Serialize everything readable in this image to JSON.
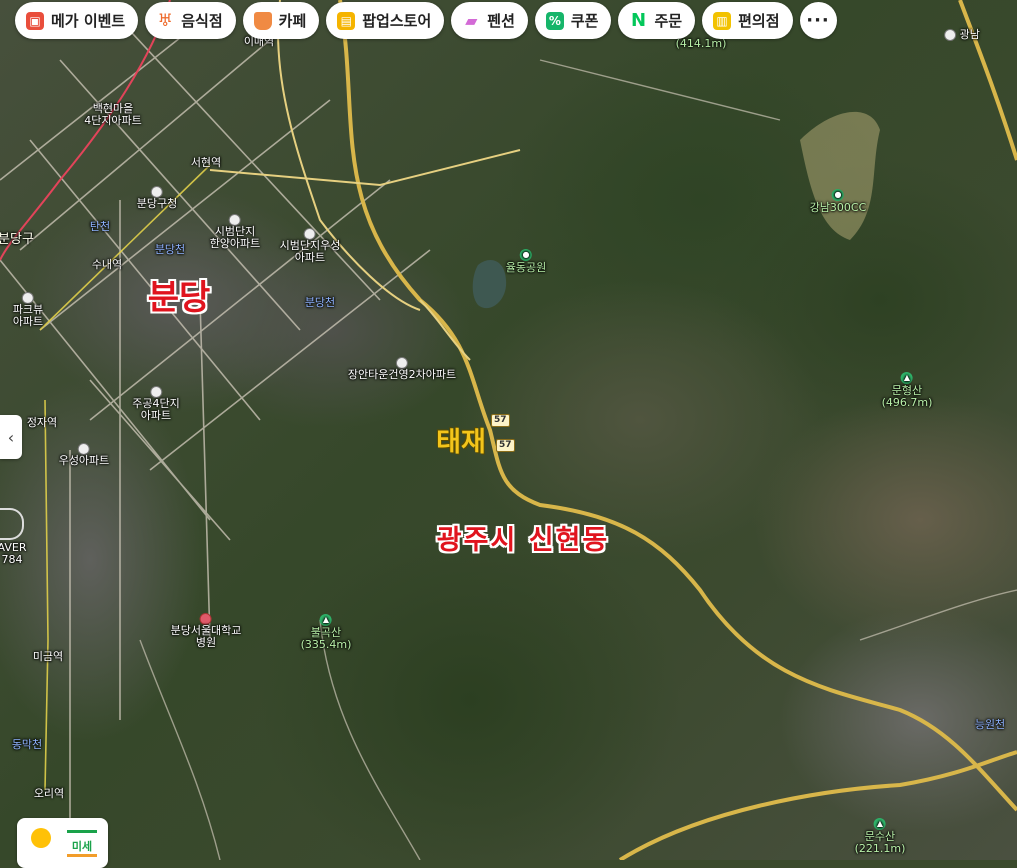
{
  "chips": [
    {
      "label": "메가 이벤트",
      "icon": "gift-icon"
    },
    {
      "label": "음식점",
      "icon": "restaurant-icon"
    },
    {
      "label": "카페",
      "icon": "coffee-icon"
    },
    {
      "label": "팝업스토어",
      "icon": "store-icon"
    },
    {
      "label": "펜션",
      "icon": "bed-icon"
    },
    {
      "label": "쿠폰",
      "icon": "coupon-icon"
    },
    {
      "label": "주문",
      "icon": "naver-order-icon"
    },
    {
      "label": "편의점",
      "icon": "convenience-store-icon"
    }
  ],
  "more_label": "···",
  "overlays": {
    "bundang": "분당",
    "taejae": "태재",
    "sinhyeon": "광주시 신현동"
  },
  "places": {
    "p1": "백현마을\n4단지아파트",
    "p2": "서현역",
    "p3": "분당구청",
    "p4": "시범단지\n한양아파트",
    "p5": "시범단지우성\n아파트",
    "p6": "탄천",
    "p7": "분당천",
    "p8": "수내역",
    "p9": "분당천",
    "p10": "장안타운건영2차아파트",
    "p11": "파크뷰\n아파트",
    "p12": "주공4단지\n아파트",
    "p13": "정자역",
    "p14": "우성아파트",
    "p15": "분당서울대학교\n병원",
    "p16": "미금역",
    "p17": "동막천",
    "p18": "오리역",
    "p19": "율동공원",
    "p20": "강남300CC",
    "p21": "광남",
    "p22": "분당구",
    "p23": "AVER\n784",
    "p24": "능원천",
    "p25": "이매역",
    "p26": "탄천",
    "p27": "정자"
  },
  "mountains": {
    "m1": "(414.1m)",
    "m2": "문형산\n(496.7m)",
    "m3": "불곡산\n(335.4m)",
    "m4": "문수산\n(221.1m)"
  },
  "route_shields": [
    "57",
    "57"
  ],
  "weather": {
    "dust_label": "미세"
  },
  "collapse_icon": "‹"
}
